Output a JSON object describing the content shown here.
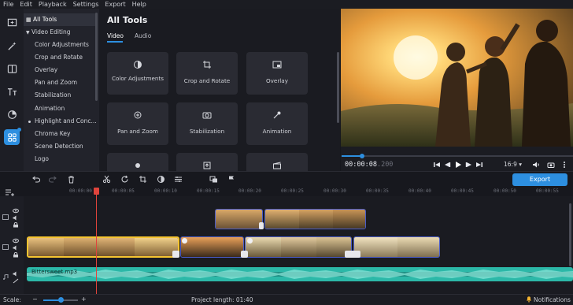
{
  "menu": [
    "File",
    "Edit",
    "Playback",
    "Settings",
    "Export",
    "Help"
  ],
  "rail": [
    {
      "name": "import-icon"
    },
    {
      "name": "magic-wand-icon"
    },
    {
      "name": "transitions-icon"
    },
    {
      "name": "titles-icon"
    },
    {
      "name": "stickers-icon"
    },
    {
      "name": "more-tools-icon",
      "active": true
    }
  ],
  "categories": {
    "all_tools": "All Tools",
    "video_editing": "Video Editing",
    "items": [
      "Color Adjustments",
      "Crop and Rotate",
      "Overlay",
      "Pan and Zoom",
      "Stabilization",
      "Animation",
      "Highlight and Conc...",
      "Chroma Key",
      "Scene Detection",
      "Logo"
    ]
  },
  "tools_panel": {
    "title": "All Tools",
    "tabs": [
      "Video",
      "Audio"
    ],
    "tiles": [
      "Color Adjustments",
      "Crop and Rotate",
      "Overlay",
      "Pan and Zoom",
      "Stabilization",
      "Animation"
    ]
  },
  "player": {
    "timecode_main": "00:00:08",
    "timecode_frac": ".200",
    "aspect": "16:9 ▾",
    "progress": 0.09
  },
  "timeline": {
    "export_label": "Export",
    "ruler": [
      "00:00:00",
      "00:00:05",
      "00:00:10",
      "00:00:15",
      "00:00:20",
      "00:00:25",
      "00:00:30",
      "00:00:35",
      "00:00:40",
      "00:00:45",
      "00:00:50",
      "00:00:55",
      "00:01:00",
      "00:01:05"
    ],
    "audio_clip_label": "Bittersweet.mp3"
  },
  "status": {
    "scale_label": "Scale:",
    "project_length": "Project length: 01:40",
    "notifications": "Notifications",
    "scale_level": 0.5
  }
}
